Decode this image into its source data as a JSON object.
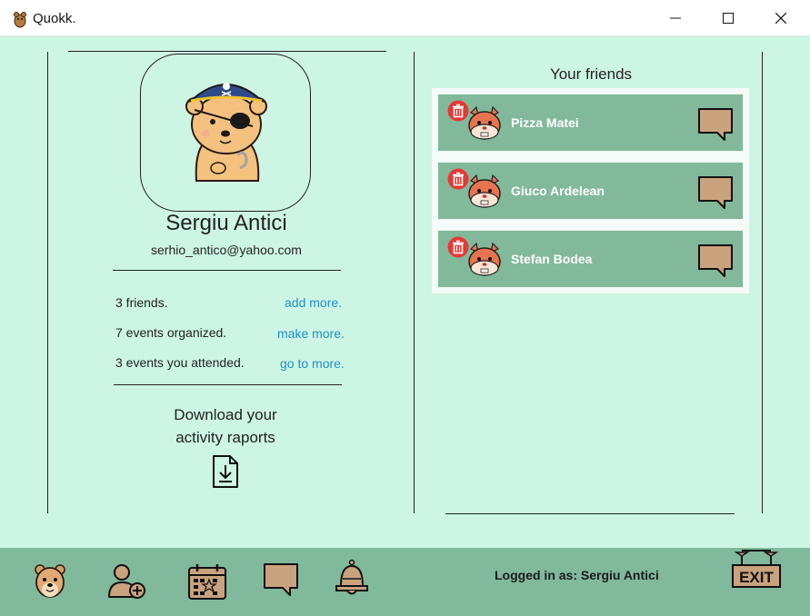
{
  "window": {
    "title": "Quokk.",
    "controls": [
      "minimize-icon",
      "maximize-icon",
      "close-icon"
    ]
  },
  "profile": {
    "name": "Sergiu Antici",
    "email": "serhio_antico@yahoo.com",
    "avatar_icon": "pirate-quokka-avatar"
  },
  "stats": [
    {
      "label": "3 friends.",
      "link": "add more."
    },
    {
      "label": "7 events organized.",
      "link": "make more."
    },
    {
      "label": "3 events you attended.",
      "link": "go to more."
    }
  ],
  "download": {
    "line1": "Download your",
    "line2": "activity raports",
    "icon": "download-file-icon"
  },
  "friends": {
    "title": "Your friends",
    "items": [
      {
        "name": "Pizza Matei"
      },
      {
        "name": "Giuco Ardelean"
      },
      {
        "name": "Stefan Bodea"
      }
    ]
  },
  "bottom_bar": {
    "icons": [
      "quokka-home-icon",
      "add-friend-icon",
      "calendar-icon",
      "chat-icon",
      "bell-icon"
    ],
    "logged_in_text": "Logged in as: Sergiu Antici",
    "exit_label": "EXIT"
  },
  "colors": {
    "background": "#cdf5e3",
    "card": "#82b99b",
    "bottom_bar": "#80b99b",
    "link": "#1e8fc9",
    "chat_icon_fill": "#c9a27e",
    "delete_red": "#e53935"
  }
}
